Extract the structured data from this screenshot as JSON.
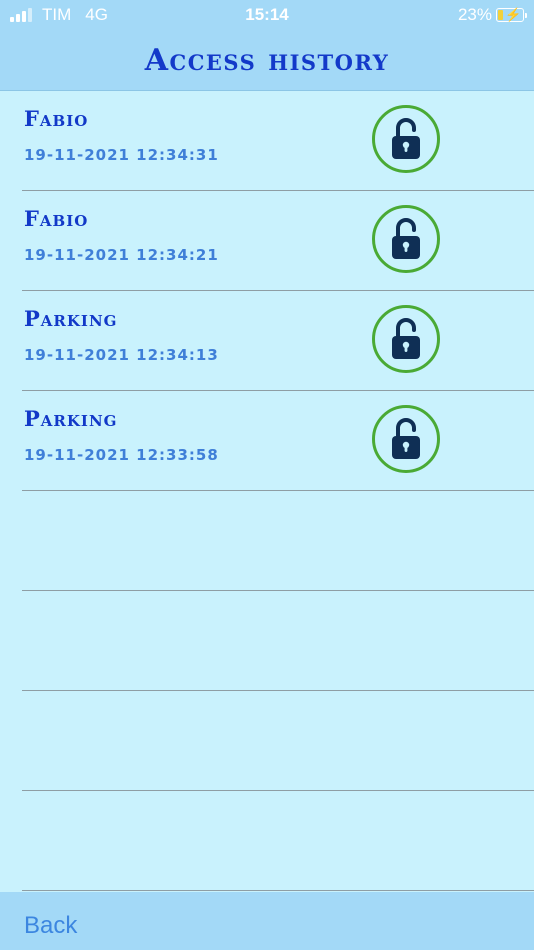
{
  "status_bar": {
    "carrier": "TIM",
    "network": "4G",
    "time": "15:14",
    "battery_percent": "23%",
    "battery_level": 0.23
  },
  "header": {
    "title": "Access history"
  },
  "entries": [
    {
      "name": "Fabio",
      "datetime": "19-11-2021 12:34:31",
      "icon": "unlocked-padlock-icon"
    },
    {
      "name": "Fabio",
      "datetime": "19-11-2021 12:34:21",
      "icon": "unlocked-padlock-icon"
    },
    {
      "name": "Parking",
      "datetime": "19-11-2021 12:34:13",
      "icon": "unlocked-padlock-icon"
    },
    {
      "name": "Parking",
      "datetime": "19-11-2021 12:33:58",
      "icon": "unlocked-padlock-icon"
    }
  ],
  "footer": {
    "back_label": "Back"
  },
  "colors": {
    "bar_background": "#a3d9f7",
    "list_background": "#c9f2fd",
    "title_blue": "#1339c9",
    "date_blue": "#3f7fd8",
    "icon_ring_green": "#4aaa35",
    "icon_navy": "#0f2f55",
    "battery_yellow": "#f2d13a"
  }
}
